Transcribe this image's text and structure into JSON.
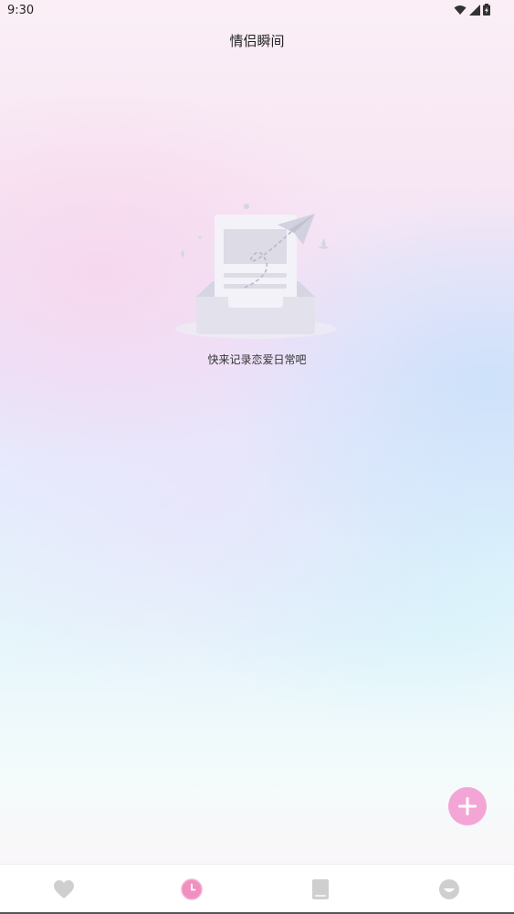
{
  "status_bar": {
    "time": "9:30",
    "icons": [
      "wifi-icon",
      "cellular-signal-icon",
      "battery-icon"
    ]
  },
  "header": {
    "title": "情侣瞬间"
  },
  "empty_state": {
    "illustration": "empty-inbox-paper-plane-illustration",
    "message": "快来记录恋爱日常吧"
  },
  "fab": {
    "icon": "plus-icon",
    "color": "#f3a6d6"
  },
  "bottom_nav": {
    "items": [
      {
        "icon": "heart-icon",
        "active": false
      },
      {
        "icon": "clock-icon",
        "active": true
      },
      {
        "icon": "book-icon",
        "active": false
      },
      {
        "icon": "smile-face-icon",
        "active": false
      }
    ],
    "active_color": "#f08fc0",
    "inactive_color": "#cfcfcf"
  }
}
